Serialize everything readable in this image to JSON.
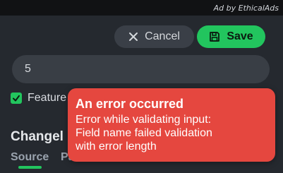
{
  "topbar": {
    "ad_text": "Ad by EthicalAds"
  },
  "actions": {
    "cancel_label": "Cancel",
    "save_label": "Save"
  },
  "form": {
    "input_value": "5",
    "checkbox_label": "Feature",
    "checkbox_checked": true
  },
  "section": {
    "title": "Changel"
  },
  "tabs": [
    {
      "label": "Source",
      "active": true
    },
    {
      "label": "Pa",
      "active": false
    }
  ],
  "toast": {
    "title": "An error occurred",
    "message_lines": [
      "Error while validating input:",
      "Field name failed validation",
      "with error length"
    ]
  },
  "colors": {
    "background": "#25292f",
    "accent_green": "#22c55e",
    "error_red": "#e5473f"
  },
  "icons": {
    "cancel": "close-icon",
    "save": "save-icon",
    "checkbox": "check-icon"
  }
}
